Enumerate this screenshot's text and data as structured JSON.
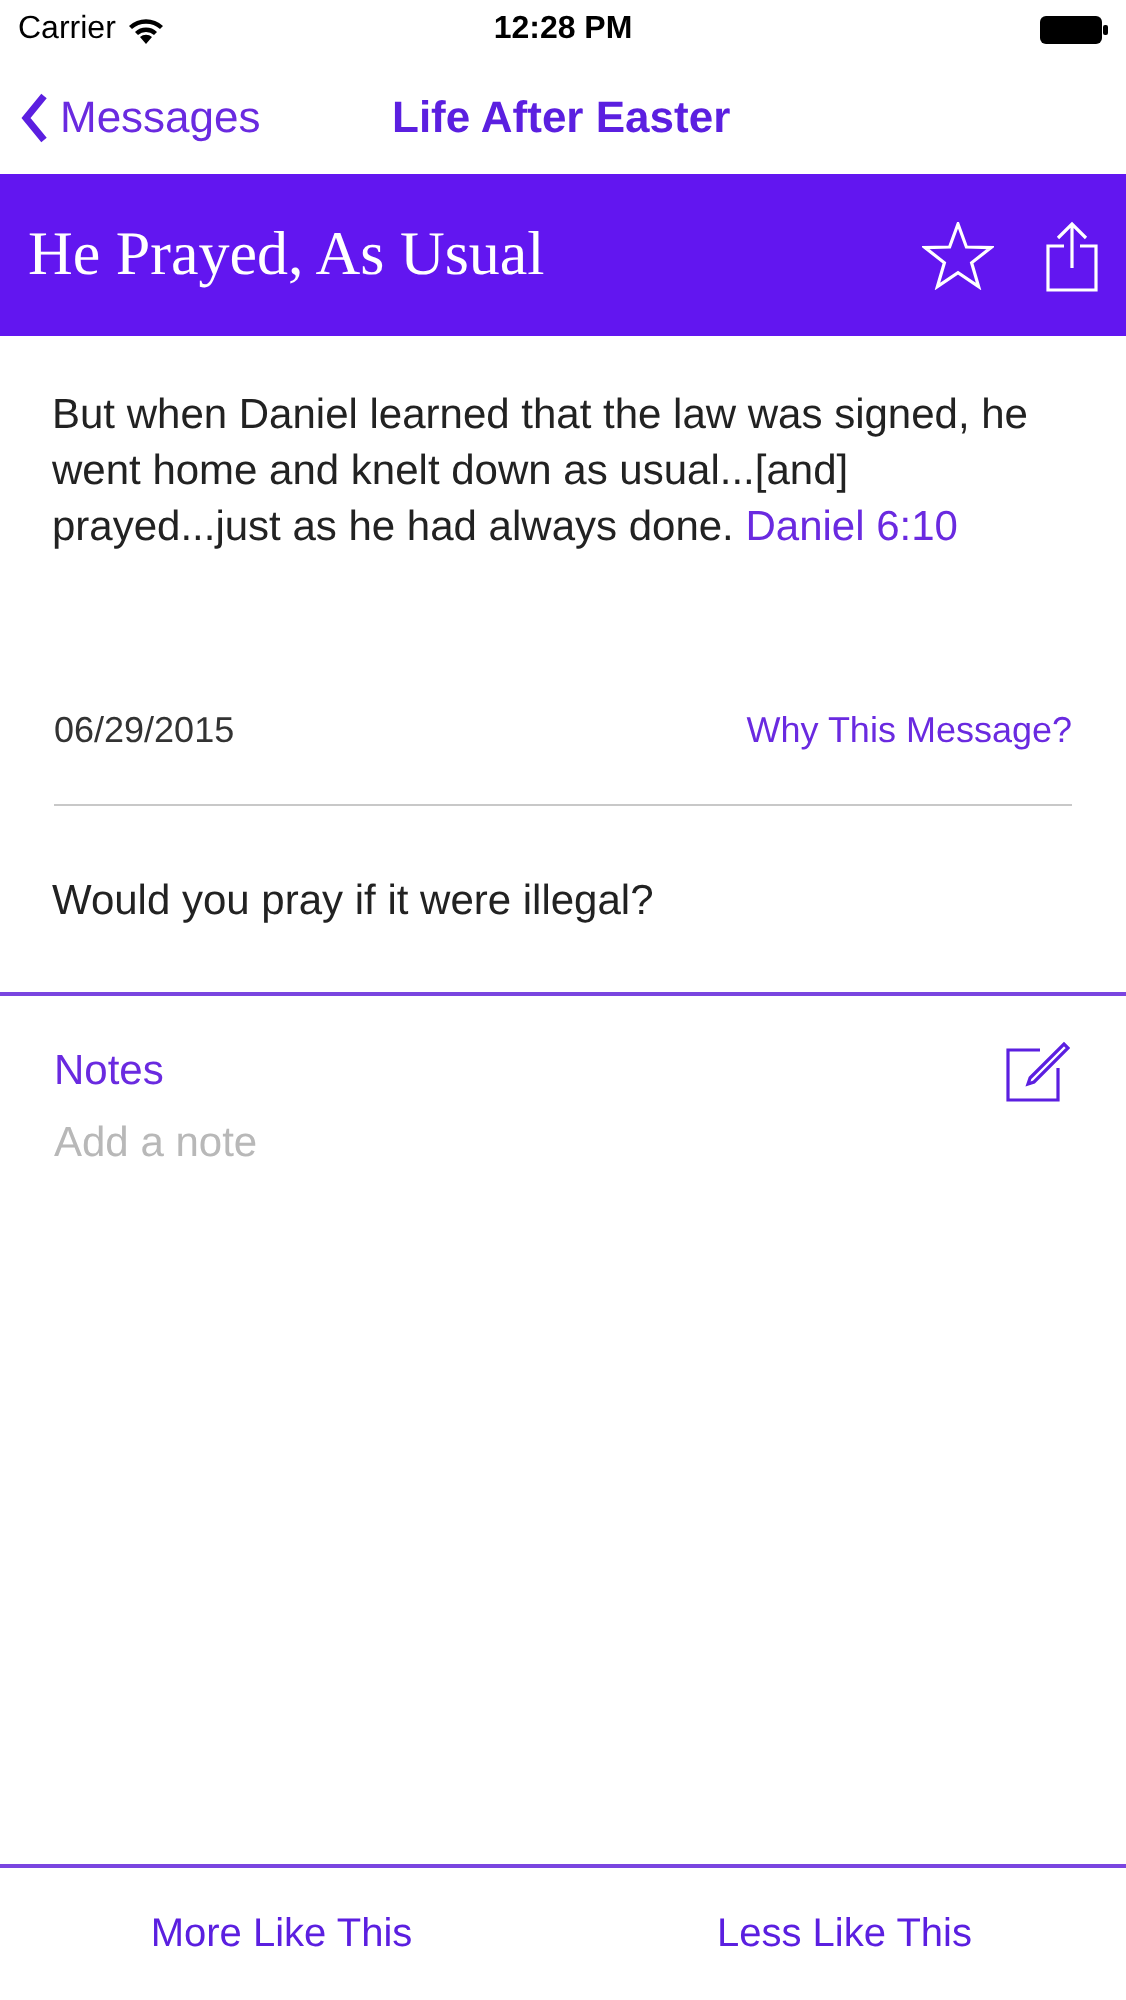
{
  "status_bar": {
    "carrier": "Carrier",
    "time": "12:28 PM"
  },
  "nav_bar": {
    "back_label": "Messages",
    "title": "Life After Easter"
  },
  "message": {
    "title": "He Prayed, As Usual",
    "starred": false
  },
  "verse": {
    "text": "But when Daniel learned that the law was signed, he went home and knelt down as usual...[and] prayed...just as he had always done.",
    "reference": "Daniel 6:10"
  },
  "date": "06/29/2015",
  "why_link": "Why This Message?",
  "question": "Would you pray if it were illegal?",
  "notes": {
    "heading": "Notes",
    "placeholder": "Add a note"
  },
  "bottom_buttons": [
    "More Like This",
    "Less Like This"
  ]
}
